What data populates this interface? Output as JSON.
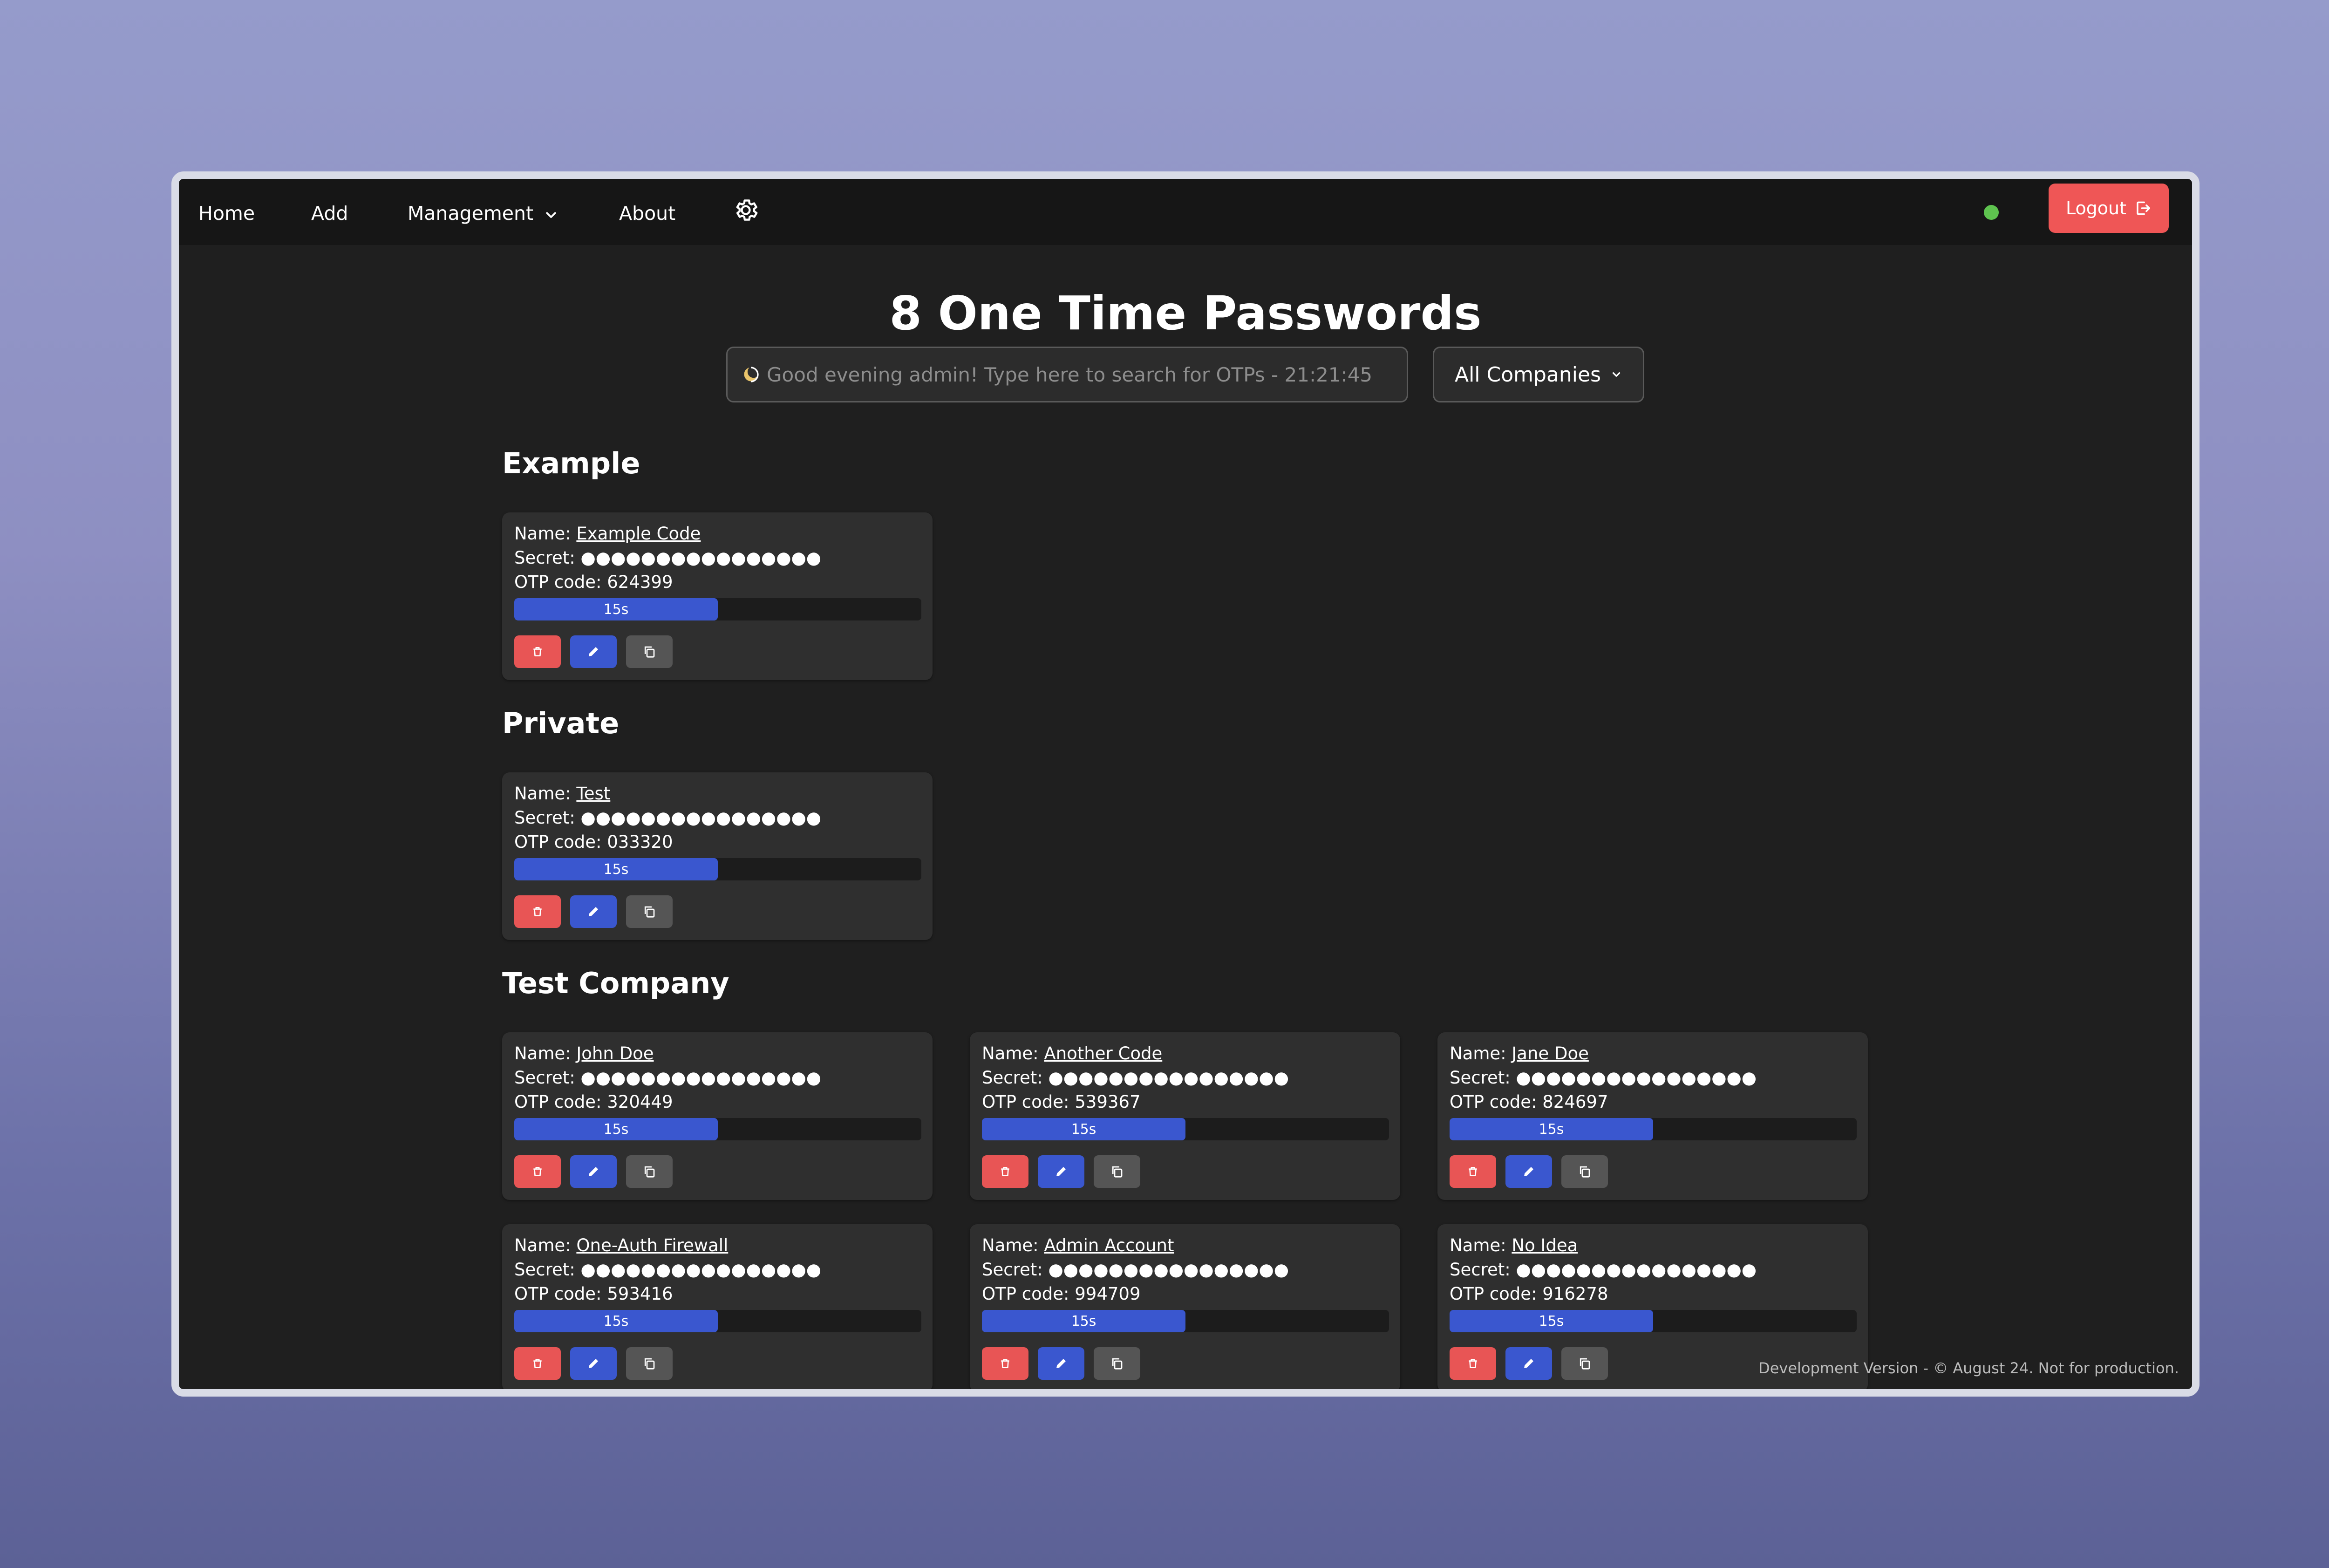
{
  "nav": {
    "items": [
      {
        "label": "Home"
      },
      {
        "label": "Add"
      },
      {
        "label": "Management"
      },
      {
        "label": "About"
      }
    ],
    "logout_label": "Logout"
  },
  "header": {
    "title": "8 One Time Passwords",
    "search_placeholder": "Good evening admin! Type here to search for OTPs - 21:21:45",
    "company_filter": "All Companies"
  },
  "labels": {
    "name": "Name:",
    "secret": "Secret:",
    "otp": "OTP code:"
  },
  "groups": [
    {
      "title": "Example",
      "cards": [
        {
          "name": "Example Code",
          "secret": "●●●●●●●●●●●●●●●●",
          "otp": "624399",
          "timer": "15s",
          "progress": 0.5
        }
      ]
    },
    {
      "title": "Private",
      "cards": [
        {
          "name": "Test",
          "secret": "●●●●●●●●●●●●●●●●",
          "otp": "033320",
          "timer": "15s",
          "progress": 0.5
        }
      ]
    },
    {
      "title": "Test Company",
      "cards": [
        {
          "name": "John Doe",
          "secret": "●●●●●●●●●●●●●●●●",
          "otp": "320449",
          "timer": "15s",
          "progress": 0.5
        },
        {
          "name": "Another Code",
          "secret": "●●●●●●●●●●●●●●●●",
          "otp": "539367",
          "timer": "15s",
          "progress": 0.5
        },
        {
          "name": "Jane Doe",
          "secret": "●●●●●●●●●●●●●●●●",
          "otp": "824697",
          "timer": "15s",
          "progress": 0.5
        },
        {
          "name": "One-Auth Firewall",
          "secret": "●●●●●●●●●●●●●●●●",
          "otp": "593416",
          "timer": "15s",
          "progress": 0.5
        },
        {
          "name": "Admin Account",
          "secret": "●●●●●●●●●●●●●●●●",
          "otp": "994709",
          "timer": "15s",
          "progress": 0.5
        },
        {
          "name": "No Idea",
          "secret": "●●●●●●●●●●●●●●●●",
          "otp": "916278",
          "timer": "15s",
          "progress": 0.5
        }
      ]
    }
  ],
  "footer": "Development Version - © August 24. Not for production.",
  "colors": {
    "accent_blue": "#3a57cf",
    "danger_red": "#e85555",
    "status_green": "#5ec34f"
  }
}
